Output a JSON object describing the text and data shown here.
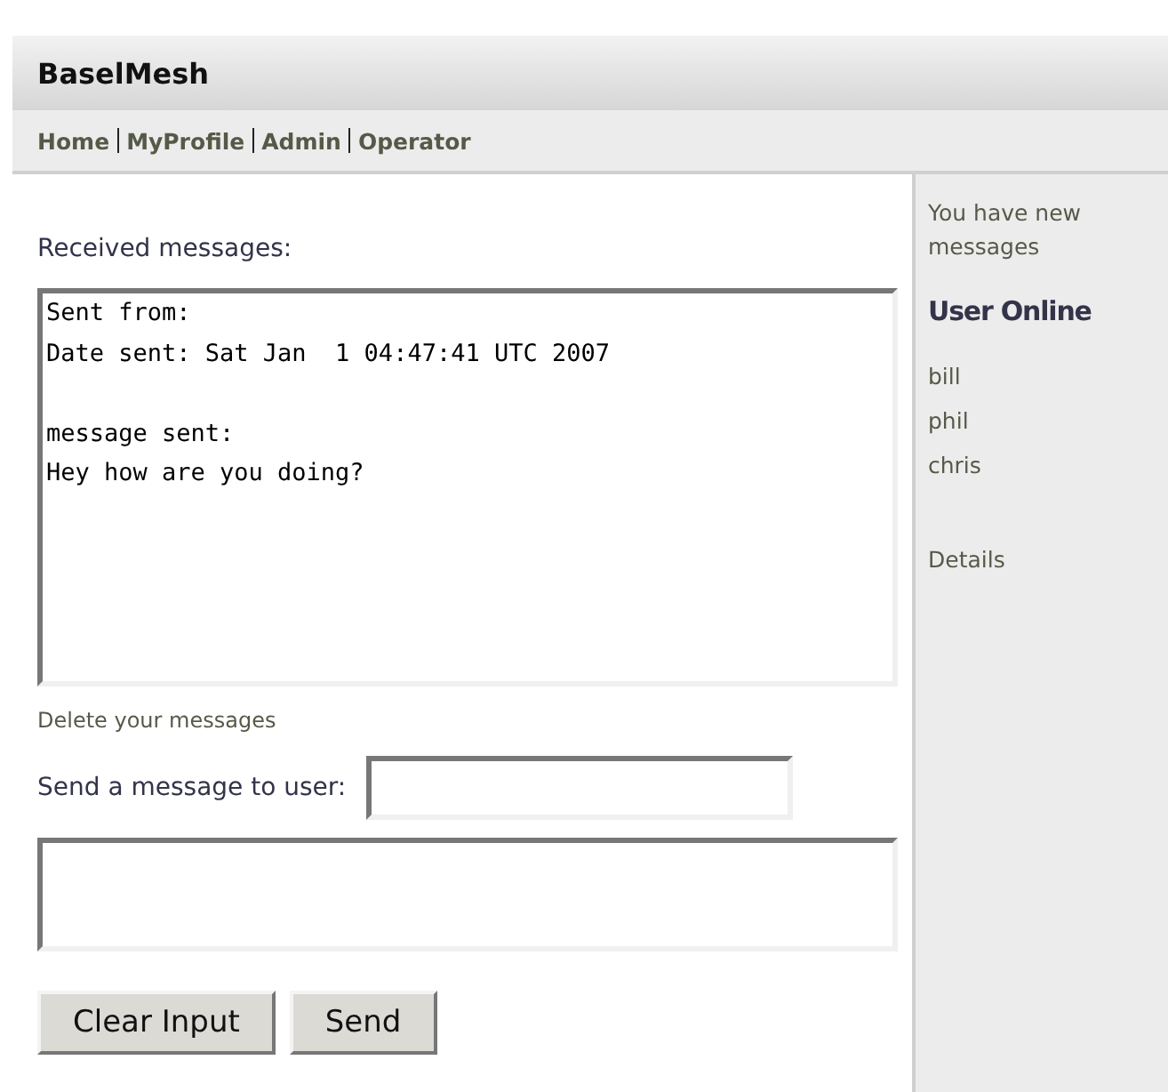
{
  "header": {
    "title": "BaselMesh"
  },
  "nav": {
    "links": [
      "Home",
      "MyProfile",
      "Admin",
      "Operator"
    ]
  },
  "main": {
    "heading": "Received messages:",
    "received_text": "Sent from:\nDate sent: Sat Jan  1 04:47:41 UTC 2007\n\nmessage sent:\nHey how are you doing?",
    "delete_link": "Delete your messages",
    "send_label": "Send a message to user:",
    "buttons": [
      "Clear Input",
      "Send"
    ]
  },
  "sidebar": {
    "notice": "You have new messages",
    "online_heading": "User Online",
    "users": [
      "bill",
      "phil",
      "chris"
    ],
    "details_link": "Details"
  }
}
